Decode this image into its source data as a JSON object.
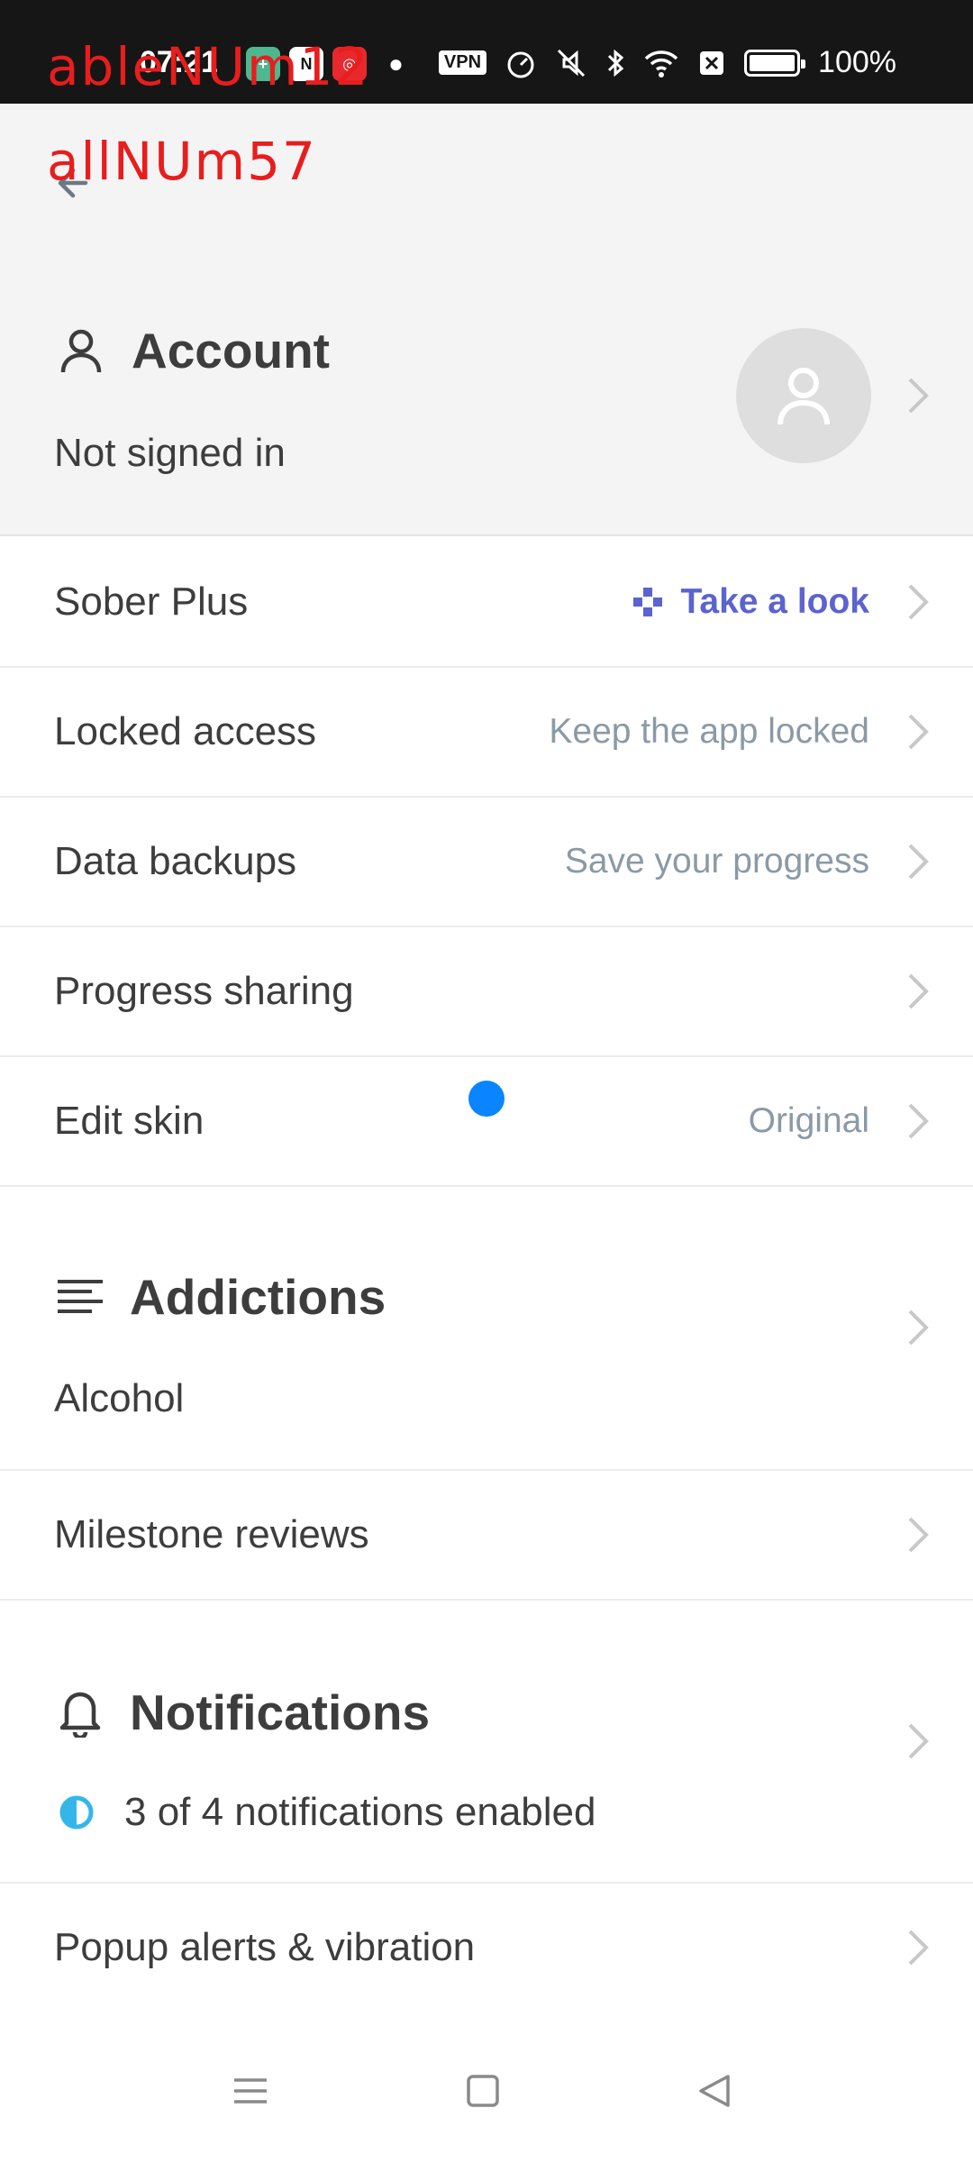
{
  "status_bar": {
    "time": "07:21",
    "vpn": "VPN",
    "battery": "100%"
  },
  "debug_overlay": {
    "line1": "ableNUm12",
    "line2": "allNUm57"
  },
  "account": {
    "title": "Account",
    "subtitle": "Not signed in"
  },
  "settings_rows": [
    {
      "label": "Sober Plus",
      "value": "Take a look"
    },
    {
      "label": "Locked access",
      "value": "Keep the app locked"
    },
    {
      "label": "Data backups",
      "value": "Save your progress"
    },
    {
      "label": "Progress sharing",
      "value": ""
    },
    {
      "label": "Edit skin",
      "value": "Original"
    }
  ],
  "addictions": {
    "title": "Addictions",
    "subtitle": "Alcohol"
  },
  "milestone_row": {
    "label": "Milestone reviews"
  },
  "notifications": {
    "title": "Notifications",
    "subtitle": "3 of 4 notifications enabled",
    "progress_fraction": 0.75
  },
  "popup_row": {
    "label": "Popup alerts & vibration"
  },
  "colors": {
    "accent": "#5b63cf",
    "value_gray": "#8a9aa6",
    "notif_blue": "#35b6ea",
    "touch_indicator": "#0a84ff"
  }
}
